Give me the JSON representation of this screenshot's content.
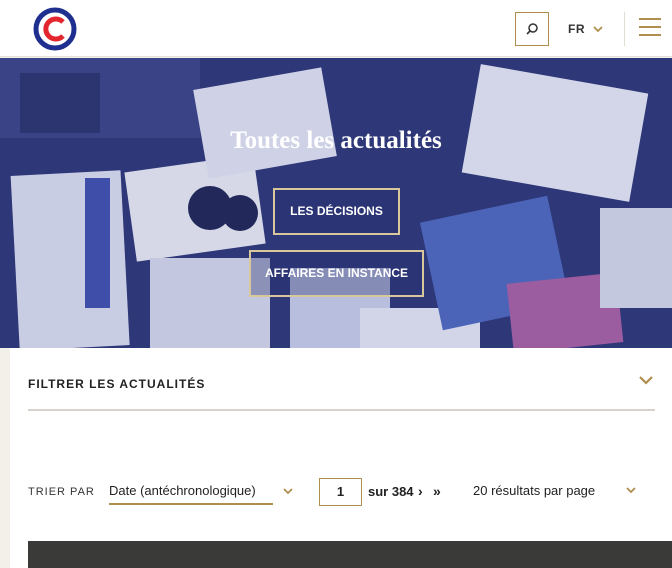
{
  "header": {
    "logo_icon": "conseil-constitutionnel-logo",
    "search_icon": "search-icon",
    "language": "FR",
    "menu_icon": "hamburger-menu-icon"
  },
  "hero": {
    "title": "Toutes les actualités",
    "button_decisions": "LES DÉCISIONS",
    "button_affaires": "AFFAIRES EN INSTANCE"
  },
  "filters": {
    "label": "FILTRER LES ACTUALITÉS"
  },
  "sort": {
    "label": "TRIER PAR",
    "selected": "Date (antéchronologique)"
  },
  "pagination": {
    "current_page": "1",
    "total": "sur 384",
    "next": "›",
    "last": "»"
  },
  "per_page": {
    "selected": "20 résultats par page"
  },
  "colors": {
    "accent_gold": "#b08f4e",
    "hero_overlay": "#2b3473",
    "logo_blue": "#1f2f8f",
    "logo_red": "#e3262e"
  }
}
